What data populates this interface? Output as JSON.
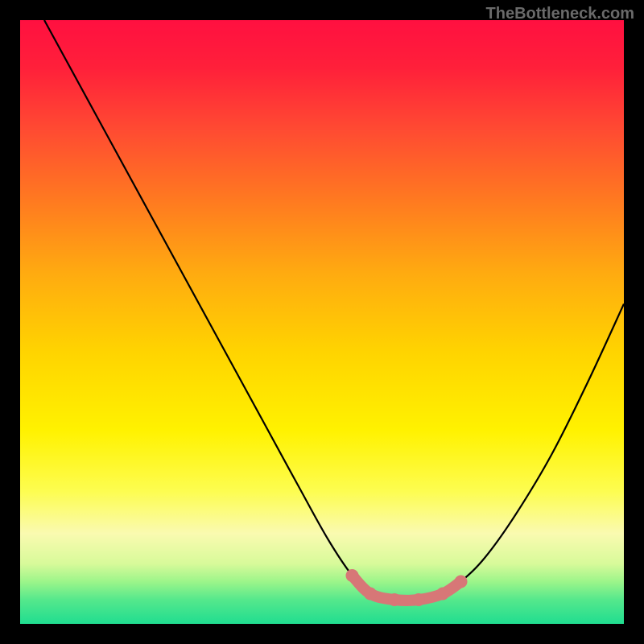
{
  "watermark": "TheBottleneck.com",
  "chart_data": {
    "type": "line",
    "title": "",
    "xlabel": "",
    "ylabel": "",
    "xlim": [
      0,
      100
    ],
    "ylim": [
      0,
      100
    ],
    "gradient_stops": [
      {
        "offset": 0.0,
        "color": "#ff1040"
      },
      {
        "offset": 0.08,
        "color": "#ff203a"
      },
      {
        "offset": 0.18,
        "color": "#ff4a32"
      },
      {
        "offset": 0.3,
        "color": "#ff7a20"
      },
      {
        "offset": 0.42,
        "color": "#ffab10"
      },
      {
        "offset": 0.55,
        "color": "#ffd400"
      },
      {
        "offset": 0.68,
        "color": "#fff200"
      },
      {
        "offset": 0.78,
        "color": "#fdfd50"
      },
      {
        "offset": 0.85,
        "color": "#fafab0"
      },
      {
        "offset": 0.9,
        "color": "#d8fa9a"
      },
      {
        "offset": 0.93,
        "color": "#9cf58a"
      },
      {
        "offset": 0.96,
        "color": "#55e88c"
      },
      {
        "offset": 1.0,
        "color": "#20dd90"
      }
    ],
    "series": [
      {
        "name": "curve",
        "x": [
          4,
          10,
          16,
          22,
          28,
          34,
          40,
          46,
          51,
          55,
          58,
          62,
          66,
          70,
          73,
          77,
          82,
          88,
          94,
          100
        ],
        "y": [
          100,
          89,
          78,
          67,
          56,
          45,
          34,
          23,
          14,
          8,
          5,
          4,
          4,
          5,
          7,
          11,
          18,
          28,
          40,
          53
        ]
      }
    ],
    "highlight": {
      "name": "bottom-highlight",
      "color": "#d77777",
      "x": [
        55,
        58,
        62,
        66,
        70,
        73
      ],
      "y": [
        8,
        5,
        4,
        4,
        5,
        7
      ]
    }
  }
}
